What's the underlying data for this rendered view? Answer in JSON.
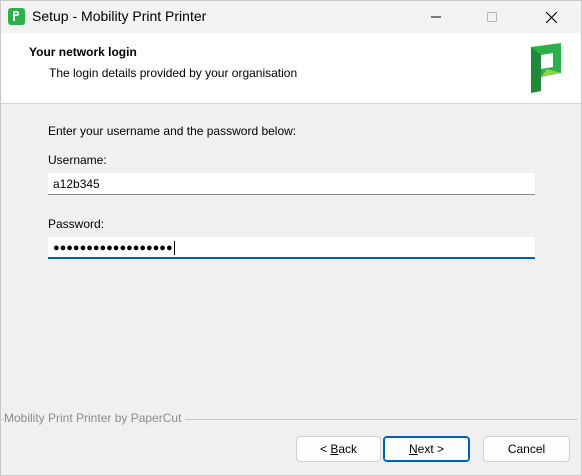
{
  "window": {
    "title": "Setup - Mobility Print Printer",
    "controls": {
      "minimize_icon": "minimize-icon",
      "maximize_icon": "maximize-icon",
      "close_icon": "close-icon"
    }
  },
  "header": {
    "title": "Your network login",
    "subtitle": "The login details provided by your organisation",
    "logo_icon": "papercut-logo-icon"
  },
  "form": {
    "instruction": "Enter your username and the password below:",
    "username": {
      "label": "Username:",
      "value": "a12b345"
    },
    "password": {
      "label": "Password:",
      "masked_value": "●●●●●●●●●●●●●●●●●●"
    }
  },
  "footer": {
    "brand": "Mobility Print Printer by PaperCut"
  },
  "buttons": {
    "back": {
      "prefix": "< ",
      "accel": "B",
      "rest": "ack"
    },
    "next": {
      "accel": "N",
      "rest": "ext >"
    },
    "cancel": "Cancel"
  },
  "colors": {
    "accent": "#005fb8",
    "brand_green": "#2bb04a",
    "window_bg": "#f0f0f0"
  }
}
